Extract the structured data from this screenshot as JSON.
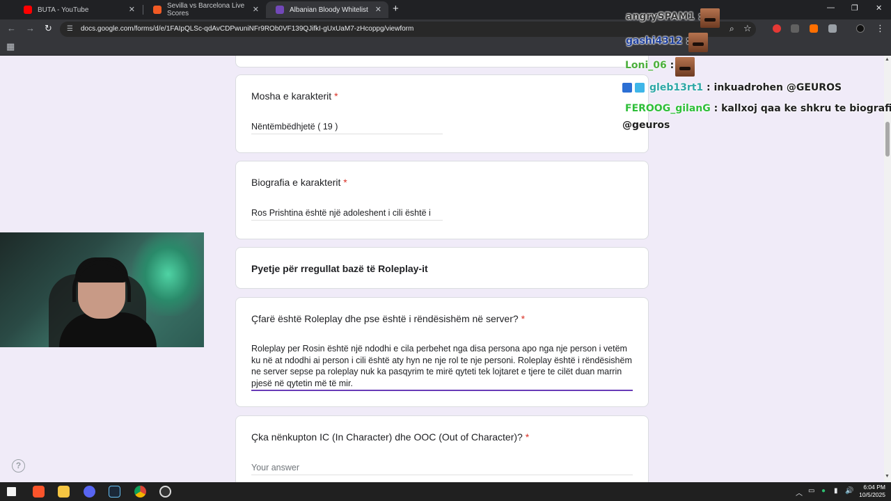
{
  "browser": {
    "tabs": [
      {
        "title": "BUTA - YouTube",
        "active": false,
        "color": "#ff0000"
      },
      {
        "title": "Sevilla vs Barcelona Live Scores",
        "active": false,
        "color": "#f15a24"
      },
      {
        "title": "Albanian Bloody Whitelist",
        "active": true,
        "color": "#7248b9"
      }
    ],
    "new_tab": "+",
    "url": "docs.google.com/forms/d/e/1FAIpQLSc-qdAvCDPwuniNFr9ROb0VF139QJifkI-gUxUaM7-zHcoppg/viewform"
  },
  "form": {
    "age": {
      "label": "Mosha e karakterit",
      "required": "*",
      "value": "Nëntëmbëdhjetë ( 19 )"
    },
    "bio": {
      "label": "Biografia e karakterit",
      "required": "*",
      "value": "Ros Prishtina është një adoleshent i cili është i"
    },
    "section": {
      "title": "Pyetje për rregullat bazë të Roleplay-it"
    },
    "roleplay": {
      "label": "Çfarë është Roleplay dhe pse është i rëndësishëm në server?",
      "required": "*",
      "value": "Roleplay per Rosin është një ndodhi e cila perbehet nga disa persona apo nga nje person i vetëm ku në at ndodhi ai person i cili është aty hyn ne nje rol te nje personi. Roleplay është i rëndësishëm ne server sepse pa roleplay nuk ka pasqyrim te mirë qyteti tek lojtaret e tjere te cilët duan marrin pjesë në qytetin më të mir."
    },
    "icooc": {
      "label": "Çka nënkupton IC (In Character) dhe OOC (Out of Character)?",
      "required": "*",
      "placeholder": "Your answer"
    }
  },
  "chat": [
    {
      "user": "angrySPAM1",
      "sep": ":",
      "text": "",
      "color": "#3a3a3a"
    },
    {
      "user": "gashi4312",
      "sep": ":",
      "text": "",
      "color": "#1e3f9c"
    },
    {
      "user": "Loni_06",
      "sep": ":",
      "text": "",
      "color": "#4caf3d"
    },
    {
      "user": "gleb13rt1",
      "sep": ":",
      "text": "inkuadrohen @GEUROS",
      "color": "#2fa7a7"
    },
    {
      "user": "FEROOG_gilanG",
      "sep": ":",
      "text": "kallxoj qaa ke shkru te biografia",
      "color": "#2fbf3a"
    },
    {
      "user": "",
      "sep": "",
      "text": "@geuros",
      "color": "#202020"
    }
  ],
  "taskbar": {
    "time": "6:04 PM",
    "date": "10/5/2025"
  }
}
